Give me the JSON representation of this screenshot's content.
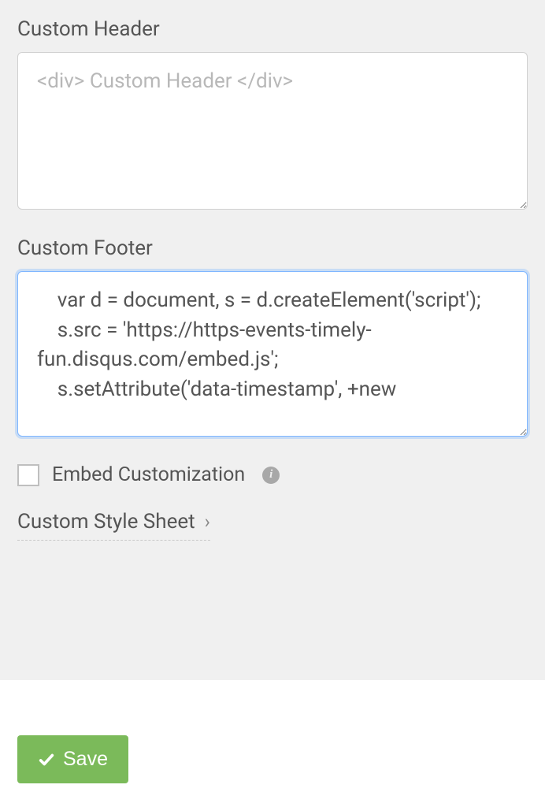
{
  "custom_header": {
    "label": "Custom Header",
    "placeholder": "<div> Custom Header </div>",
    "value": ""
  },
  "custom_footer": {
    "label": "Custom Footer",
    "value": "    var d = document, s = d.createElement('script');\n    s.src = 'https://https-events-timely-fun.disqus.com/embed.js';\n    s.setAttribute('data-timestamp', +new "
  },
  "embed_customization": {
    "label": "Embed Customization",
    "checked": false
  },
  "custom_style_sheet": {
    "label": "Custom Style Sheet"
  },
  "actions": {
    "save_label": "Save"
  }
}
